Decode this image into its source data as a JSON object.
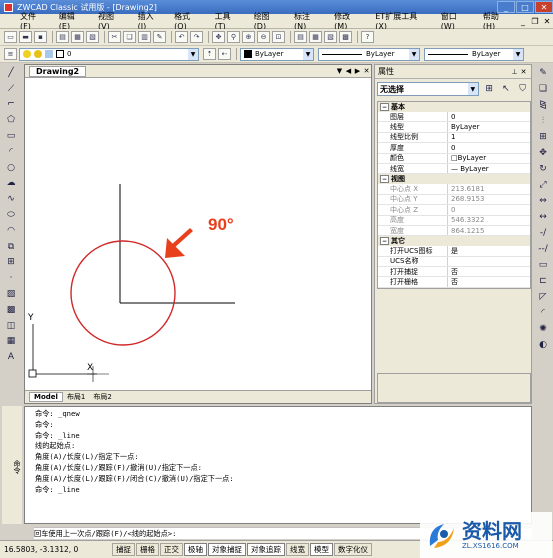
{
  "window": {
    "title": "ZWCAD Classic 试用版 - [Drawing2]"
  },
  "menu": [
    "文件(F)",
    "编辑(E)",
    "视图(V)",
    "插入(I)",
    "格式(O)",
    "工具(T)",
    "绘图(D)",
    "标注(N)",
    "修改(M)",
    "ET扩展工具(X)",
    "窗口(W)",
    "帮助(H)"
  ],
  "layers": {
    "current_layer": "0",
    "color": "ByLayer",
    "linetype": "ByLayer",
    "lineweight": "ByLayer"
  },
  "drawing": {
    "tab_name": "Drawing2",
    "annotation": "90°",
    "ucs_x": "X",
    "ucs_y": "Y",
    "layout_tabs": [
      "Model",
      "布局1",
      "布局2"
    ]
  },
  "colors": {
    "annotation": "#e8401c",
    "circle": "#d02828"
  },
  "properties": {
    "title": "属性",
    "selection": "无选择",
    "categories": [
      {
        "name": "基本",
        "rows": [
          {
            "key": "图层",
            "value": "0",
            "disabled": false
          },
          {
            "key": "线型",
            "value": "ByLayer",
            "disabled": false
          },
          {
            "key": "线型比例",
            "value": "1",
            "disabled": false
          },
          {
            "key": "厚度",
            "value": "0",
            "disabled": false
          },
          {
            "key": "颜色",
            "value": "□ByLayer",
            "disabled": false
          },
          {
            "key": "线宽",
            "value": "— ByLayer",
            "disabled": false
          }
        ]
      },
      {
        "name": "视图",
        "rows": [
          {
            "key": "中心点 X",
            "value": "213.6181",
            "disabled": true
          },
          {
            "key": "中心点 Y",
            "value": "268.9153",
            "disabled": true
          },
          {
            "key": "中心点 Z",
            "value": "0",
            "disabled": true
          },
          {
            "key": "高度",
            "value": "546.3322",
            "disabled": true
          },
          {
            "key": "宽度",
            "value": "864.1215",
            "disabled": true
          }
        ]
      },
      {
        "name": "其它",
        "rows": [
          {
            "key": "打开UCS图标",
            "value": "是",
            "disabled": false
          },
          {
            "key": "UCS名称",
            "value": "",
            "disabled": false
          },
          {
            "key": "打开捕捉",
            "value": "否",
            "disabled": false
          },
          {
            "key": "打开栅格",
            "value": "否",
            "disabled": false
          }
        ]
      }
    ]
  },
  "command": {
    "label": "命令",
    "history": [
      "命令: _qnew",
      "命令:",
      "命令: _line",
      "线的起始点:",
      "角度(A)/长度(L)/指定下一点:",
      "角度(A)/长度(L)/跟踪(F)/撤消(U)/指定下一点:",
      "角度(A)/长度(L)/跟踪(F)/闭合(C)/撤消(U)/指定下一点:",
      "命令: _line"
    ],
    "prompt": "回车使用上一次点/跟踪(F)/<线的起始点>:"
  },
  "status": {
    "coords": "16.5803, -3.1312, 0",
    "buttons": [
      {
        "label": "捕捉",
        "on": false
      },
      {
        "label": "栅格",
        "on": false
      },
      {
        "label": "正交",
        "on": false
      },
      {
        "label": "极轴",
        "on": true
      },
      {
        "label": "对象捕捉",
        "on": true
      },
      {
        "label": "对象追踪",
        "on": true
      },
      {
        "label": "线宽",
        "on": false
      },
      {
        "label": "模型",
        "on": true
      },
      {
        "label": "数字化仪",
        "on": false
      }
    ]
  },
  "watermark": {
    "name": "资料网",
    "url": "ZL.XS1616.COM"
  }
}
